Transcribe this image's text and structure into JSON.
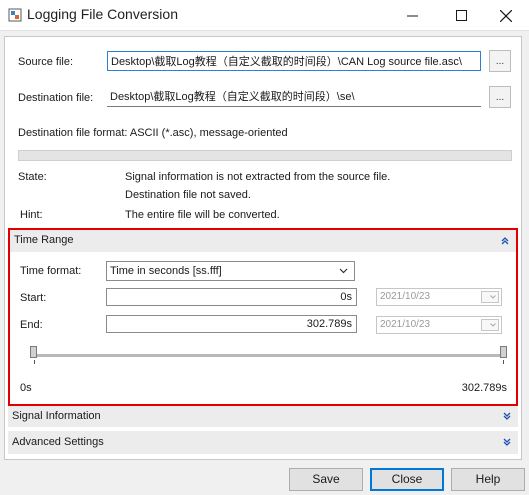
{
  "window": {
    "title": "Logging File Conversion"
  },
  "source": {
    "label": "Source file:",
    "value": "\\Desktop\\截取Log教程（自定义截取的时间段）\\CAN Log source file.asc",
    "browse_label": "..."
  },
  "destination": {
    "label": "Destination file:",
    "value": "\\Desktop\\截取Log教程（自定义截取的时间段）\\se",
    "browse_label": "...",
    "format_text": "Destination file format: ASCII (*.asc), message-oriented"
  },
  "status": {
    "state_label": "State:",
    "state_line1": "Signal information is not extracted from the source file.",
    "state_line2": "Destination file not saved.",
    "hint_label": "Hint:",
    "hint_text": "The entire file will be converted."
  },
  "time_range": {
    "title": "Time Range",
    "format_label": "Time format:",
    "format_value": "Time in seconds [ss.fff]",
    "start_label": "Start:",
    "start_value": "0s",
    "start_date": "2021/10/23",
    "end_label": "End:",
    "end_value": "302.789s",
    "end_date": "2021/10/23",
    "slider_min_label": "0s",
    "slider_max_label": "302.789s",
    "slider_start_fraction": 0.0,
    "slider_end_fraction": 1.0
  },
  "sections": {
    "signal_info": "Signal Information",
    "advanced": "Advanced Settings"
  },
  "buttons": {
    "save": "Save",
    "close": "Close",
    "help": "Help"
  },
  "colors": {
    "highlight_border": "#e00000",
    "accent": "#0078d7",
    "chevron": "#1a4fb4"
  }
}
